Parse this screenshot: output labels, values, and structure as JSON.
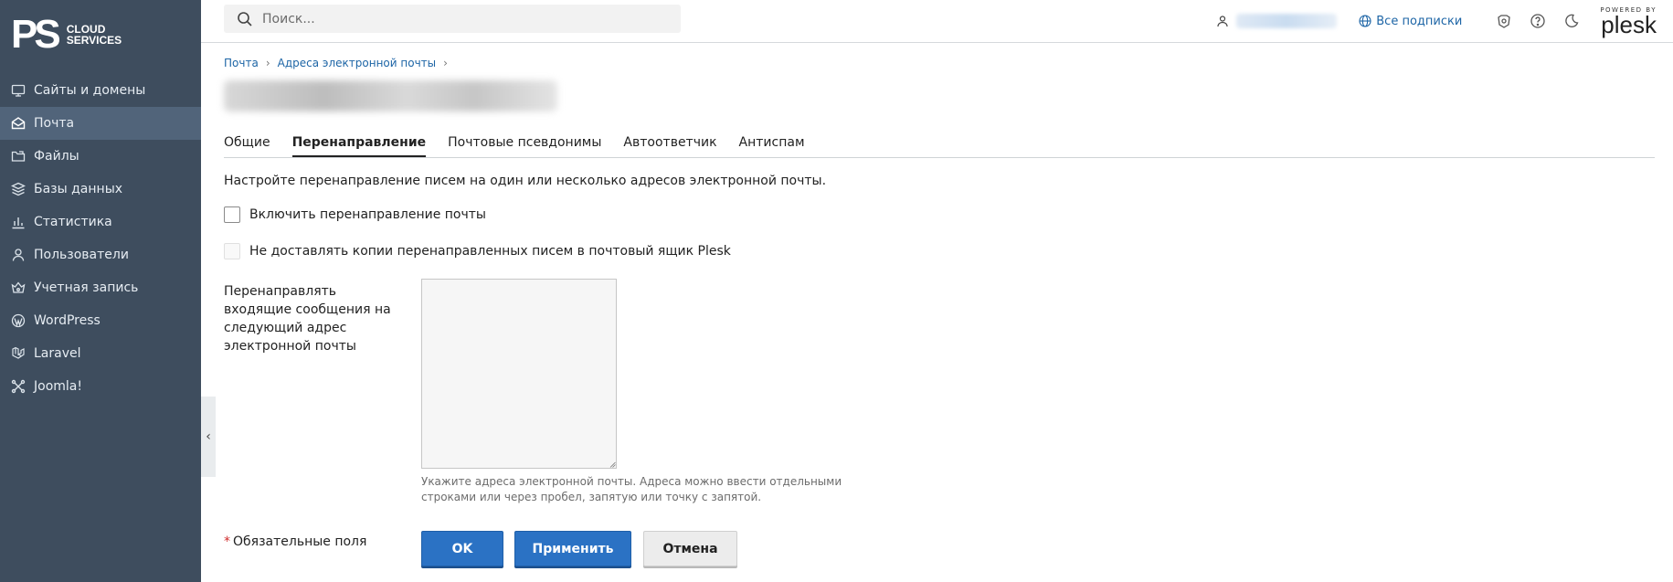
{
  "brand": {
    "mark": "PS",
    "line1": "CLOUD",
    "line2": "SERVICES"
  },
  "sidebar": {
    "items": [
      {
        "label": "Сайты и домены",
        "icon": "monitor-icon"
      },
      {
        "label": "Почта",
        "icon": "mail-icon",
        "active": true
      },
      {
        "label": "Файлы",
        "icon": "folder-icon"
      },
      {
        "label": "Базы данных",
        "icon": "database-layers-icon"
      },
      {
        "label": "Статистика",
        "icon": "bar-chart-icon"
      },
      {
        "label": "Пользователи",
        "icon": "user-icon"
      },
      {
        "label": "Учетная запись",
        "icon": "account-icon"
      },
      {
        "label": "WordPress",
        "icon": "wordpress-icon"
      },
      {
        "label": "Laravel",
        "icon": "laravel-icon"
      },
      {
        "label": "Joomla!",
        "icon": "joomla-icon"
      }
    ],
    "collapse_glyph": "‹"
  },
  "header": {
    "search_placeholder": "Поиск...",
    "subscriptions_label": "Все подписки",
    "powered_by": "POWERED BY",
    "plesk": "plesk"
  },
  "breadcrumb": {
    "item1": "Почта",
    "item2": "Адреса электронной почты",
    "sep": "›"
  },
  "tabs": [
    {
      "label": "Общие"
    },
    {
      "label": "Перенаправление",
      "active": true
    },
    {
      "label": "Почтовые псевдонимы"
    },
    {
      "label": "Автоответчик"
    },
    {
      "label": "Антиспам"
    }
  ],
  "form": {
    "description": "Настройте перенаправление писем на один или несколько адресов электронной почты.",
    "enable_forwarding_label": "Включить перенаправление почты",
    "no_copies_label": "Не доставлять копии перенаправленных писем в почтовый ящик Plesk",
    "forward_to_label": "Перенаправлять входящие сообщения на следующий адрес электронной почты",
    "forward_to_value": "",
    "hint": "Укажите адреса электронной почты. Адреса можно ввести отдельными строками или через пробел, запятую или точку с запятой.",
    "required_star": "*",
    "required_label": "Обязательные поля",
    "ok_label": "OK",
    "apply_label": "Применить",
    "cancel_label": "Отмена"
  },
  "colors": {
    "sidebar_bg": "#3e4d5e",
    "sidebar_active": "#51647a",
    "primary": "#2b72c4",
    "link": "#1d65a6"
  }
}
